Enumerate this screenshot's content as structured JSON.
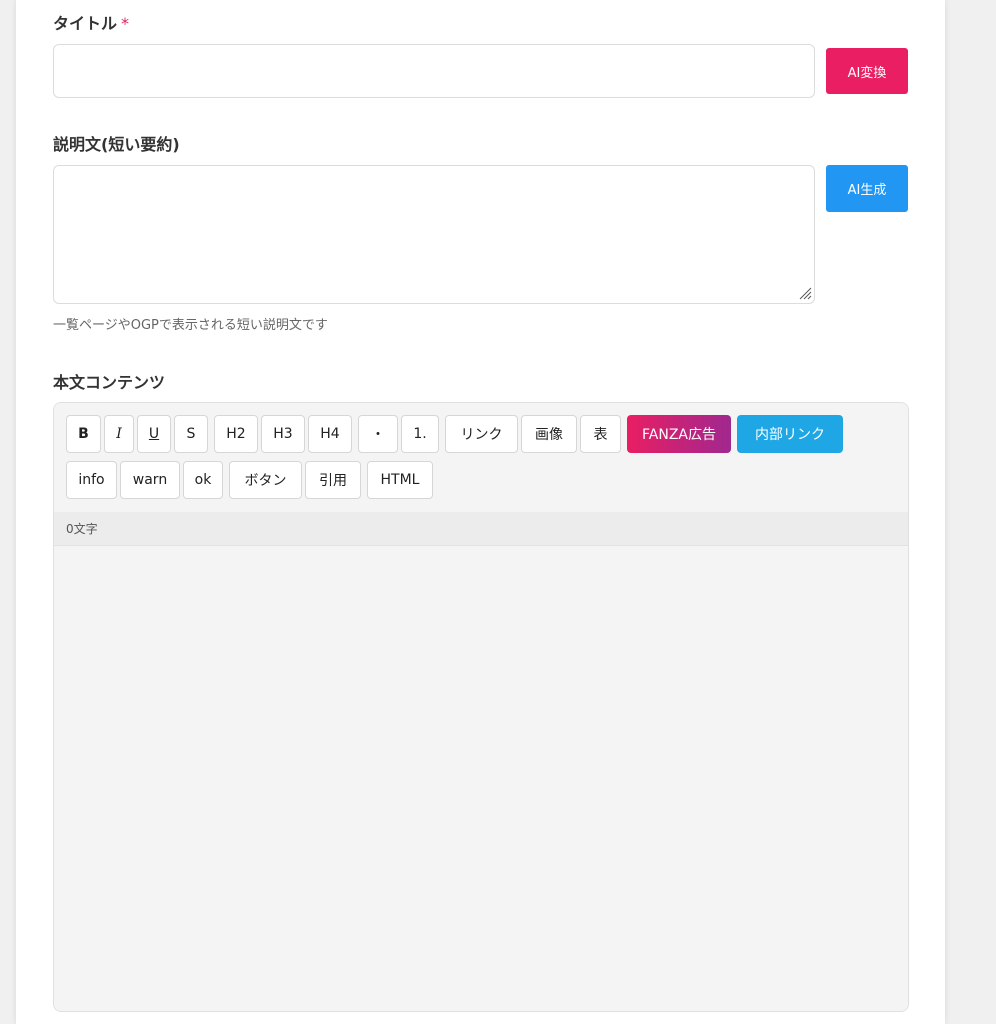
{
  "title_field": {
    "label": "タイトル",
    "required_mark": "*",
    "value": "",
    "ai_button": "AI変換",
    "ai_color": "#e91e63"
  },
  "description_field": {
    "label": "説明文(短い要約)",
    "value": "",
    "ai_button": "AI生成",
    "ai_color": "#2196f3",
    "hint": "一覧ページやOGPで表示される短い説明文です"
  },
  "content_field": {
    "label": "本文コンテンツ",
    "toolbar": {
      "bold": "B",
      "italic": "I",
      "underline": "U",
      "strike": "S",
      "h2": "H2",
      "h3": "H3",
      "h4": "H4",
      "bullet": "・",
      "ordered": "1.",
      "link": "リンク",
      "image": "画像",
      "table": "表",
      "fanza_ad": "FANZA広告",
      "internal_link": "内部リンク",
      "info": "info",
      "warn": "warn",
      "ok": "ok",
      "button": "ボタン",
      "quote": "引用",
      "html": "HTML"
    },
    "char_count": "0文字",
    "value": ""
  },
  "colors": {
    "fanza_gradient_start": "#e91e63",
    "fanza_gradient_end": "#9c27b0",
    "internal_link": "#1ea7e4"
  }
}
